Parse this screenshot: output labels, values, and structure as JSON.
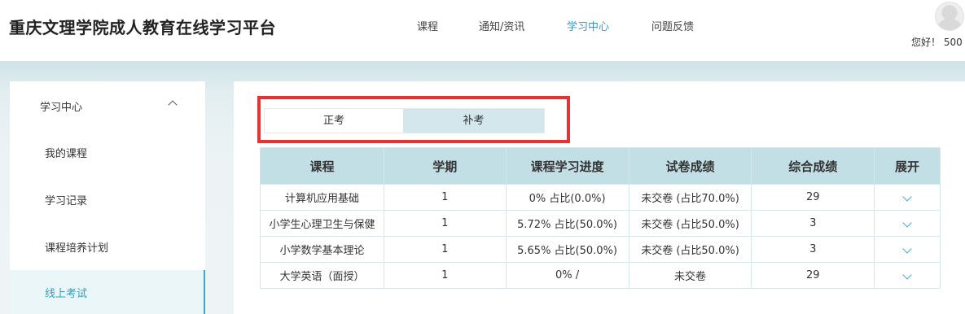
{
  "header": {
    "brand": "重庆文理学院成人教育在线学习平台",
    "nav": [
      "课程",
      "通知/资讯",
      "学习中心",
      "问题反馈"
    ],
    "active_nav": 2,
    "greeting": "您好！ 500"
  },
  "sidebar": {
    "title": "学习中心",
    "items": [
      {
        "label": "我的课程"
      },
      {
        "label": "学习记录"
      },
      {
        "label": "课程培养计划"
      },
      {
        "label": "线上考试"
      }
    ],
    "active_item": 3
  },
  "exam_tabs": {
    "items": [
      "正考",
      "补考"
    ],
    "active": 1
  },
  "table": {
    "columns": [
      "课程",
      "学期",
      "课程学习进度",
      "试卷成绩",
      "综合成绩",
      "展开"
    ],
    "rows": [
      {
        "course": "计算机应用基础",
        "term": "1",
        "progress": "0% 占比(0.0%)",
        "paper": "未交卷 (占比70.0%)",
        "total": "29"
      },
      {
        "course": "小学生心理卫生与保健",
        "term": "1",
        "progress": "5.72% 占比(50.0%)",
        "paper": "未交卷 (占比50.0%)",
        "total": "3"
      },
      {
        "course": "小学数学基本理论",
        "term": "1",
        "progress": "5.65% 占比(50.0%)",
        "paper": "未交卷 (占比50.0%)",
        "total": "3"
      },
      {
        "course": "大学英语（面授）",
        "term": "1",
        "progress": "0% /",
        "paper": "未交卷",
        "total": "29"
      }
    ]
  },
  "colors": {
    "accent": "#3fa8c4",
    "nav_active": "#3b96c9",
    "header_row": "#c2dfe6",
    "highlight": "#e53232"
  }
}
